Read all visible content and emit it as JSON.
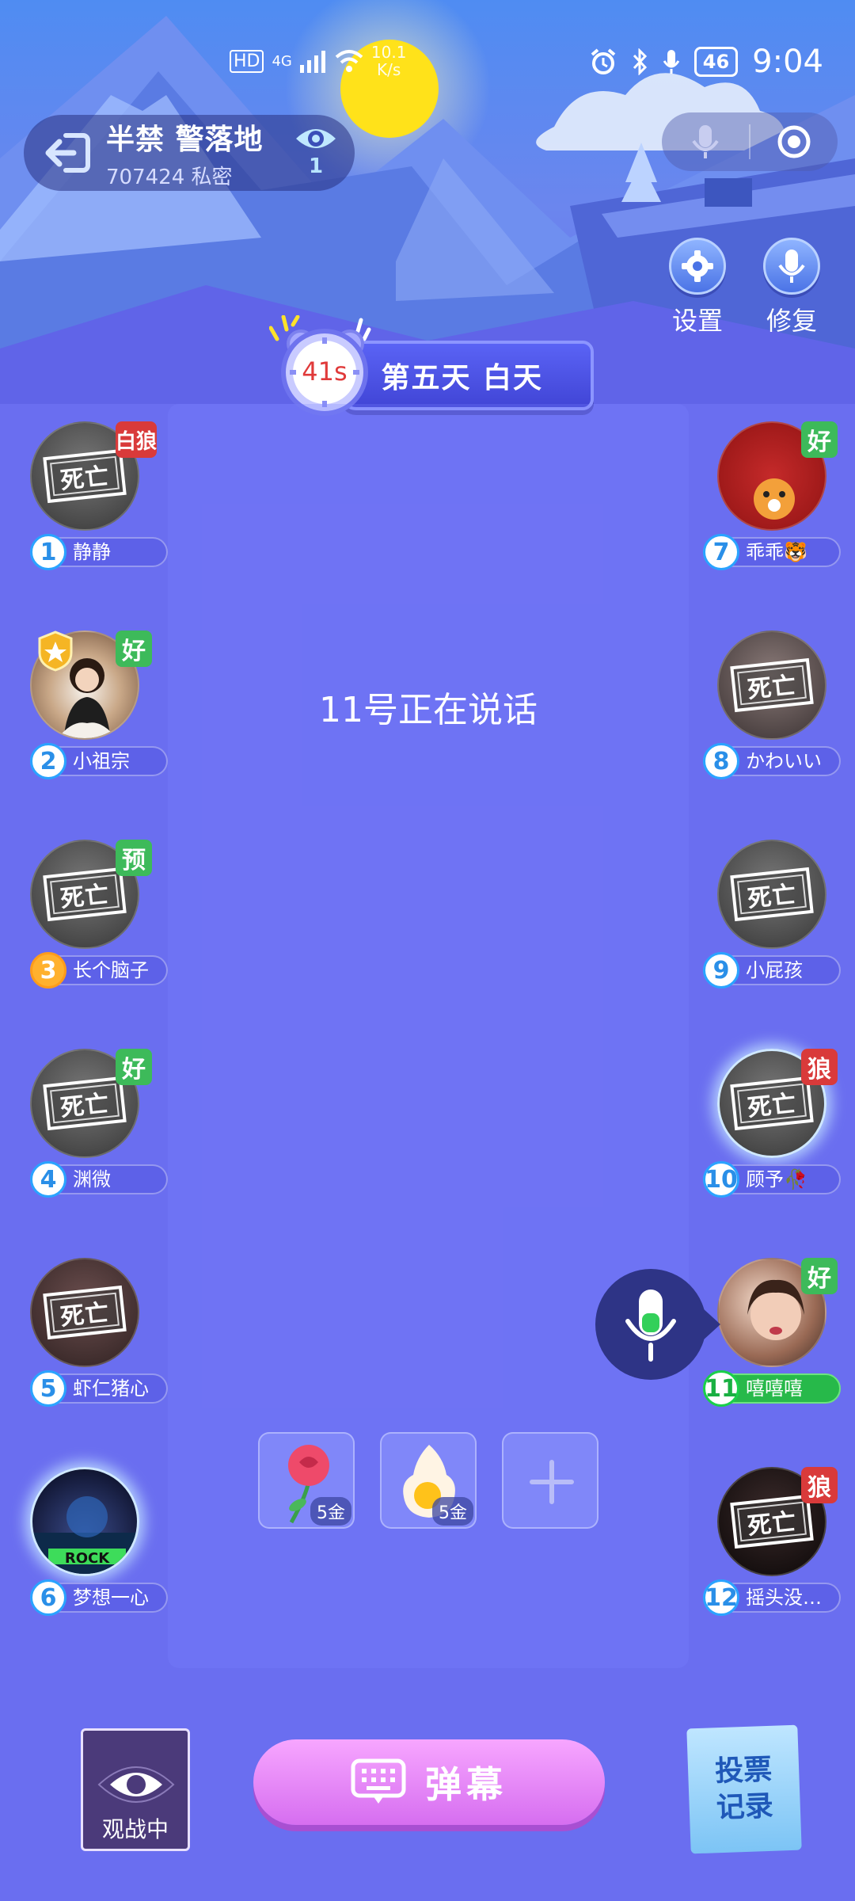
{
  "status_bar": {
    "hd_label": "HD",
    "network_label": "4G",
    "speed_value": "10.1",
    "speed_unit": "K/s",
    "battery": "46",
    "time": "9:04"
  },
  "room": {
    "name": "半禁 警落地",
    "meta": "707424 私密",
    "viewer_count": "1"
  },
  "tools": {
    "settings_label": "设置",
    "repair_label": "修复"
  },
  "timer": {
    "seconds": "41s",
    "phase": "第五天 白天"
  },
  "center": {
    "speaking_text": "11号正在说话"
  },
  "players": {
    "left": [
      {
        "seat": "1",
        "name": "静静",
        "badge": "白狼",
        "dead": "死亡"
      },
      {
        "seat": "2",
        "name": "小祖宗",
        "badge": "好"
      },
      {
        "seat": "3",
        "name": "长个脑子",
        "badge": "预",
        "dead": "死亡"
      },
      {
        "seat": "4",
        "name": "渊微",
        "badge": "好",
        "dead": "死亡"
      },
      {
        "seat": "5",
        "name": "虾仁猪心",
        "dead": "死亡"
      },
      {
        "seat": "6",
        "name": "梦想一心"
      }
    ],
    "right": [
      {
        "seat": "7",
        "name": "乖乖🐯",
        "badge": "好"
      },
      {
        "seat": "8",
        "name": "かわいい",
        "dead": "死亡"
      },
      {
        "seat": "9",
        "name": "小屁孩",
        "dead": "死亡"
      },
      {
        "seat": "10",
        "name": "顾予🥀",
        "badge": "狼",
        "dead": "死亡"
      },
      {
        "seat": "11",
        "name": "嘻嘻嘻",
        "badge": "好"
      },
      {
        "seat": "12",
        "name": "摇头没…",
        "badge": "狼",
        "dead": "死亡"
      }
    ]
  },
  "gifts": [
    {
      "name": "rose",
      "price": "5金"
    },
    {
      "name": "egg",
      "price": "5金"
    }
  ],
  "bottom": {
    "spectate_label": "观战中",
    "danmaku_label": "弹幕",
    "vote_line1": "投票",
    "vote_line2": "记录"
  },
  "colors": {
    "background": "#6a6ef0",
    "good_badge": "#3dba5a",
    "wolf_badge": "#d93a3a",
    "active_speaker": "#27b94a",
    "danmaku_button": "#e58af7"
  },
  "icons": [
    "exit-icon",
    "eye-icon",
    "mic-icon",
    "record-icon",
    "gear-icon",
    "mic-repair-icon",
    "clock-icon",
    "keyboard-icon",
    "eye-card-icon",
    "plus-icon"
  ]
}
